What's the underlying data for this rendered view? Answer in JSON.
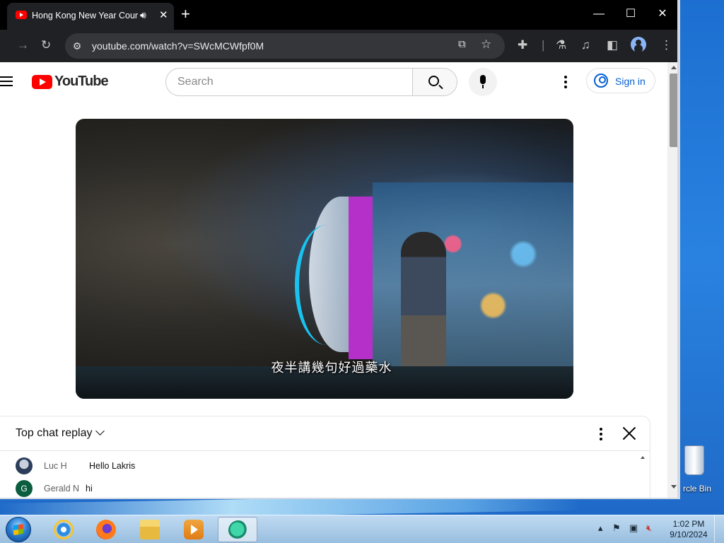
{
  "browser": {
    "tab_title": "Hong Kong New Year Cour",
    "new_tab_label": "+",
    "url": "youtube.com/watch?v=SWcMCWfpf0M",
    "window_controls": {
      "minimize": "—",
      "maximize": "☐",
      "close": "✕"
    }
  },
  "youtube": {
    "logo_text": "YouTube",
    "search_placeholder": "Search",
    "sign_in_label": "Sign in"
  },
  "video": {
    "subtitle": "夜半講幾句好過藥水"
  },
  "chat": {
    "title": "Top chat replay",
    "messages": [
      {
        "author": "Luc H",
        "text": "Hello Lakris"
      },
      {
        "author": "Gerald N",
        "text": "hi",
        "avatar_letter": "G"
      }
    ]
  },
  "desktop": {
    "recycle_bin_label": "rcle Bin"
  },
  "taskbar": {
    "time": "1:02 PM",
    "date": "9/10/2024",
    "apps": [
      "internet-explorer-icon",
      "firefox-icon",
      "file-explorer-icon",
      "media-player-icon",
      "chat-app-icon"
    ]
  },
  "colors": {
    "youtube_red": "#ff0000",
    "link_blue": "#065fd4",
    "browser_dark": "#202124"
  }
}
